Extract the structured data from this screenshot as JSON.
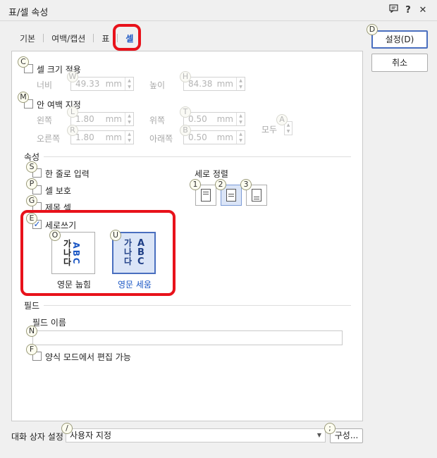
{
  "window": {
    "title": "표/셀 속성",
    "icons": {
      "comment": "comment-icon",
      "help": "?",
      "close": "✕"
    }
  },
  "tabs": [
    "기본",
    "여백/캡션",
    "표",
    "셀"
  ],
  "active_tab": "셀",
  "buttons": {
    "ok": "설정(D)",
    "ok_badge": "D",
    "cancel": "취소",
    "compose": "구성..."
  },
  "cell_size": {
    "badge": "C",
    "label": "셀 크기 적용",
    "width_label": "너비",
    "width_badge": "W",
    "width_value": "49.33",
    "height_label": "높이",
    "height_badge": "H",
    "height_value": "84.38",
    "unit": "mm"
  },
  "inner_margin": {
    "badge": "M",
    "label": "안 여백 지정",
    "left_label": "왼쪽",
    "left_badge": "L",
    "left_value": "1.80",
    "top_label": "위쪽",
    "top_badge": "T",
    "top_value": "0.50",
    "right_label": "오른쪽",
    "right_badge": "R",
    "right_value": "1.80",
    "bottom_label": "아래쪽",
    "bottom_badge": "B",
    "bottom_value": "0.50",
    "all_label": "모두",
    "all_badge": "A",
    "unit": "mm"
  },
  "properties": {
    "section": "속성",
    "single_line": {
      "badge": "S",
      "label": "한 줄로 입력"
    },
    "protect": {
      "badge": "P",
      "label": "셀 보호"
    },
    "header": {
      "badge": "G",
      "label": "제목 셀"
    },
    "vertical": {
      "badge": "E",
      "label": "세로쓰기",
      "checked": "✓"
    },
    "valign_label": "세로 정렬",
    "valign_badges": [
      "1",
      "2",
      "3"
    ],
    "rotate": {
      "badge": "O",
      "label": "영문 눕힘",
      "korean": [
        "가",
        "나",
        "다"
      ],
      "latin": "ABC"
    },
    "upright": {
      "badge": "U",
      "label": "영문 세움",
      "korean": [
        "가",
        "나",
        "다"
      ],
      "latin": [
        "A",
        "B",
        "C"
      ]
    }
  },
  "field": {
    "section": "필드",
    "name_label": "필드 이름",
    "name_badge": "N",
    "name_value": "",
    "form_edit": {
      "badge": "F",
      "label": "양식 모드에서 편집 가능"
    }
  },
  "dialog_setting": {
    "label": "대화 상자 설정",
    "badge": "/",
    "value": "사용자 지정",
    "compose_badge": ";"
  },
  "colors": {
    "accent": "#1a56c4",
    "highlight": "#e8121b",
    "selected_bg": "#dbe5f7"
  }
}
